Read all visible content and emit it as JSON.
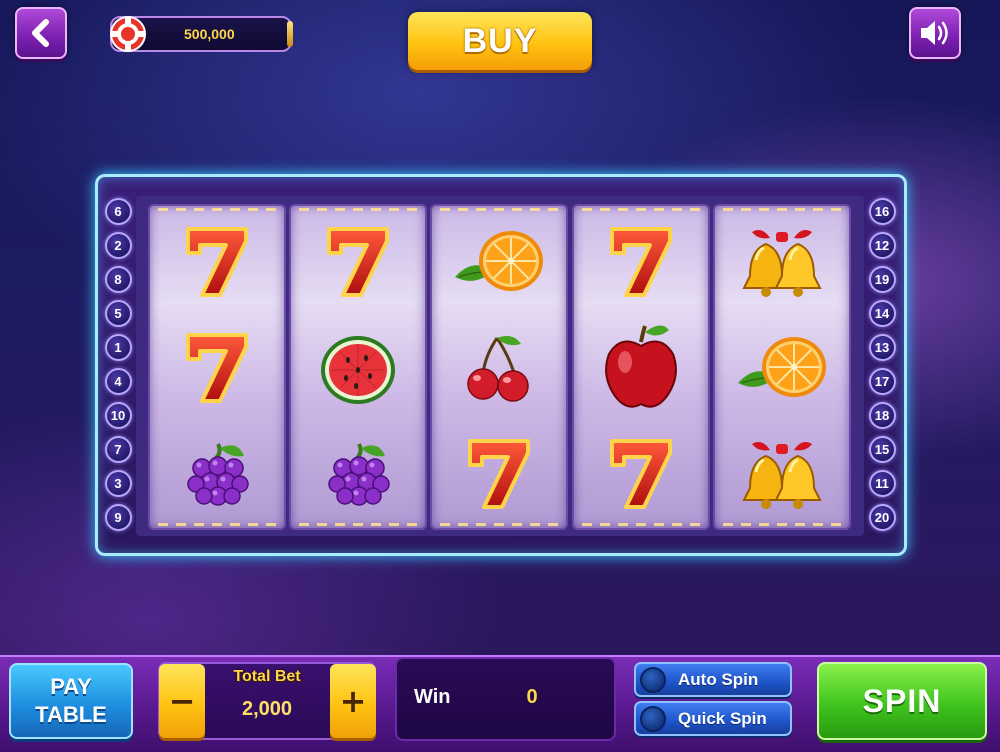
{
  "header": {
    "coins": "500,000",
    "buy_label": "BUY"
  },
  "reels": [
    [
      "seven",
      "seven",
      "grapes"
    ],
    [
      "seven",
      "watermelon",
      "grapes"
    ],
    [
      "orange",
      "cherry",
      "seven"
    ],
    [
      "seven",
      "apple",
      "seven"
    ],
    [
      "bell",
      "orange",
      "bell"
    ]
  ],
  "paylines": {
    "left": [
      "6",
      "2",
      "8",
      "5",
      "1",
      "4",
      "10",
      "7",
      "3",
      "9"
    ],
    "right": [
      "16",
      "12",
      "19",
      "14",
      "13",
      "17",
      "18",
      "15",
      "11",
      "20"
    ]
  },
  "controls": {
    "pay_table_line1": "PAY",
    "pay_table_line2": "TABLE",
    "total_bet_label": "Total Bet",
    "total_bet_value": "2,000",
    "minus_label": "−",
    "plus_label": "+",
    "win_label": "Win",
    "win_value": "0",
    "auto_spin_label": "Auto Spin",
    "quick_spin_label": "Quick Spin",
    "spin_label": "SPIN"
  },
  "colors": {
    "accent_purple": "#7a1fb0",
    "buy_gold": "#ffc312",
    "spin_green": "#3fc41e",
    "frame_cyan": "#a8ecff"
  }
}
